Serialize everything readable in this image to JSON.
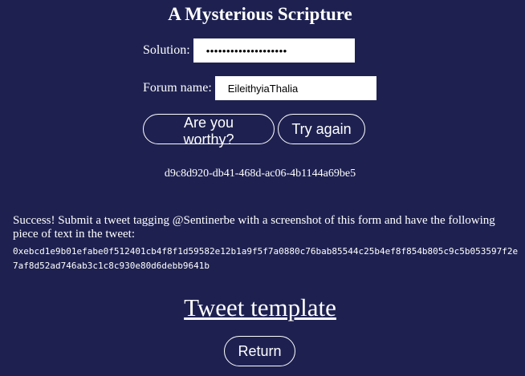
{
  "header": {
    "title": "A Mysterious Scripture"
  },
  "form": {
    "solution_label": "Solution:",
    "solution_value": "••••••••••••••••••••",
    "forum_label": "Forum name:",
    "forum_value": "EileithyiaThalia"
  },
  "buttons": {
    "worthy_label": "Are you worthy?",
    "try_again_label": "Try again",
    "return_label": "Return"
  },
  "result": {
    "uuid": "d9c8d920-db41-468d-ac06-4b1144a69be5",
    "success_message": "Success! Submit a tweet tagging @Sentinerbe with a screenshot of this form and have the following piece of text in the tweet:",
    "hash": "0xebcd1e9b01efabe0f512401cb4f8f1d59582e12b1a9f5f7a0880c76bab85544c25b4ef8f854b805c9c5b053597f2e7af8d52ad746ab3c1c8c930e80d6debb9641b"
  },
  "links": {
    "tweet_template": "Tweet template"
  }
}
